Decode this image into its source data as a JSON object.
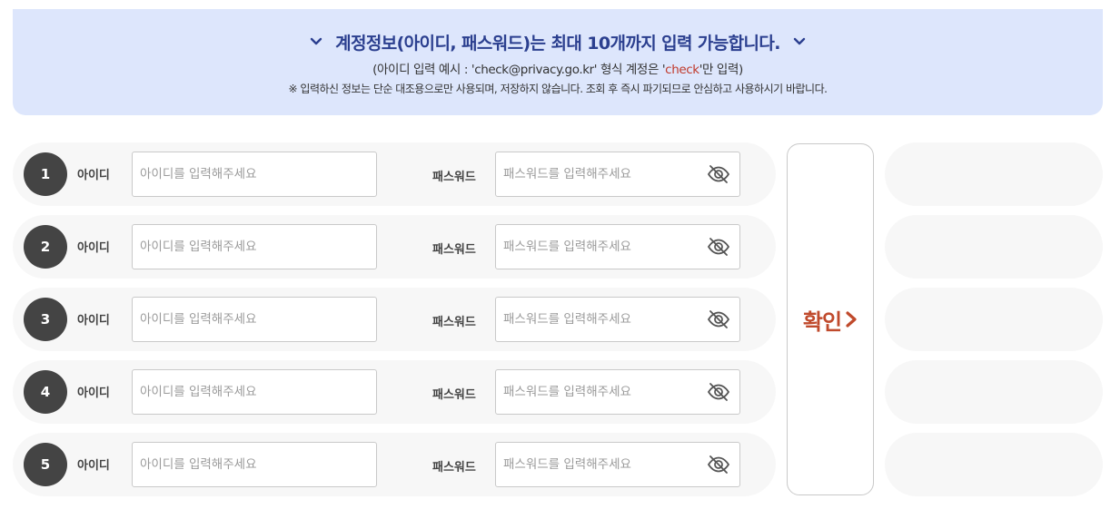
{
  "banner": {
    "title": "계정정보(아이디, 패스워드)는 최대 10개까지 입력 가능합니다.",
    "example_prefix": "(아이디 입력 예시 : 'check@privacy.go.kr' 형식 계정은 '",
    "example_highlight": "check",
    "example_suffix": "'만 입력)",
    "notice": "※ 입력하신 정보는 단순 대조용으로만 사용되며, 저장하지 않습니다. 조회 후 즉시 파기되므로 안심하고 사용하시기 바랍니다.",
    "highlight_color": "#c0392b"
  },
  "rows": [
    {
      "number": "1",
      "id_label": "아이디",
      "id_placeholder": "아이디를 입력해주세요",
      "id_value": "",
      "pw_label": "패스워드",
      "pw_placeholder": "패스워드를 입력해주세요",
      "pw_value": "",
      "toggle_icon": "eye-slash-icon"
    },
    {
      "number": "2",
      "id_label": "아이디",
      "id_placeholder": "아이디를 입력해주세요",
      "id_value": "",
      "pw_label": "패스워드",
      "pw_placeholder": "패스워드를 입력해주세요",
      "pw_value": "",
      "toggle_icon": "eye-slash-icon"
    },
    {
      "number": "3",
      "id_label": "아이디",
      "id_placeholder": "아이디를 입력해주세요",
      "id_value": "",
      "pw_label": "패스워드",
      "pw_placeholder": "패스워드를 입력해주세요",
      "pw_value": "",
      "toggle_icon": "eye-slash-icon"
    },
    {
      "number": "4",
      "id_label": "아이디",
      "id_placeholder": "아이디를 입력해주세요",
      "id_value": "",
      "pw_label": "패스워드",
      "pw_placeholder": "패스워드를 입력해주세요",
      "pw_value": "",
      "toggle_icon": "eye-slash-icon"
    },
    {
      "number": "5",
      "id_label": "아이디",
      "id_placeholder": "아이디를 입력해주세요",
      "id_value": "",
      "pw_label": "패스워드",
      "pw_placeholder": "패스워드를 입력해주세요",
      "pw_value": "",
      "toggle_icon": "eye-slash-icon"
    }
  ],
  "confirm": {
    "label": "확인",
    "icon": "chevron-right-icon",
    "color": "#c04a2c"
  },
  "colors": {
    "banner_bg": "#dde6fc",
    "banner_title": "#2b3f8f",
    "number_badge": "#444444",
    "row_bg": "#f7f7f7"
  }
}
